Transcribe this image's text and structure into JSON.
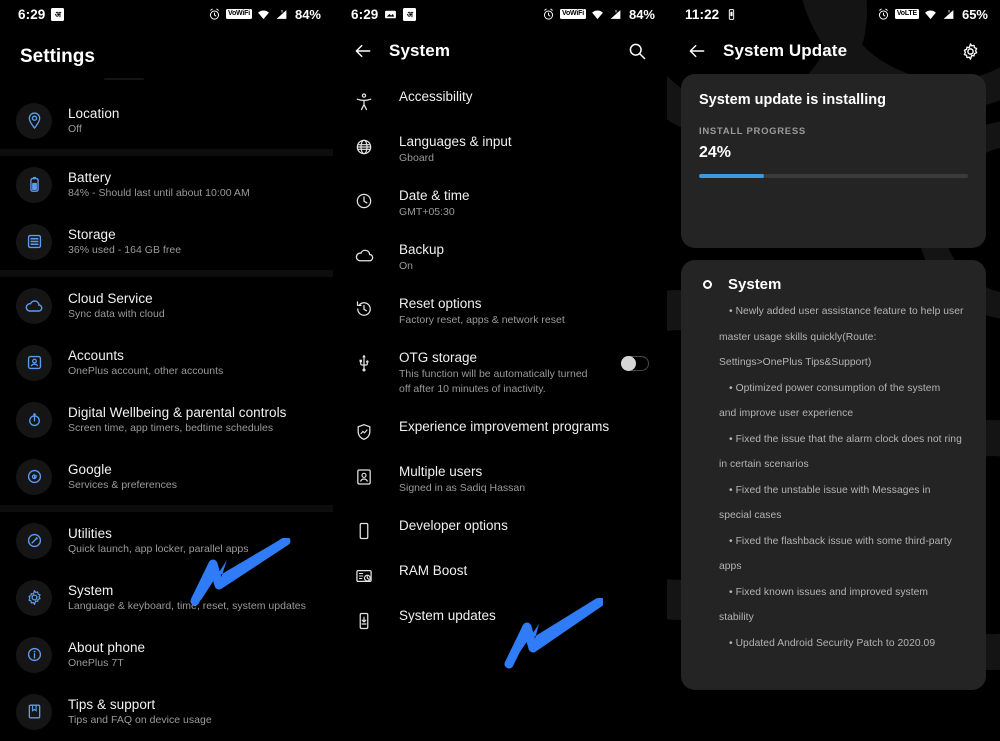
{
  "panels": {
    "settings": {
      "statusbar": {
        "time": "6:29",
        "notif_icon": "app-notification-icon",
        "alarm": "alarm-icon",
        "vowifi": "VoWiFi",
        "battery": "84%"
      },
      "title": "Settings",
      "items": [
        {
          "icon": "location-icon",
          "title": "Location",
          "sub": "Off"
        },
        {
          "icon": "battery-icon",
          "title": "Battery",
          "sub": "84% - Should last until about 10:00 AM"
        },
        {
          "icon": "storage-icon",
          "title": "Storage",
          "sub": "36% used - 164 GB free"
        },
        {
          "icon": "cloud-icon",
          "title": "Cloud Service",
          "sub": "Sync data with cloud"
        },
        {
          "icon": "accounts-icon",
          "title": "Accounts",
          "sub": "OnePlus account, other accounts"
        },
        {
          "icon": "wellbeing-icon",
          "title": "Digital Wellbeing & parental controls",
          "sub": "Screen time, app timers, bedtime schedules"
        },
        {
          "icon": "google-icon",
          "title": "Google",
          "sub": "Services & preferences"
        },
        {
          "icon": "utilities-icon",
          "title": "Utilities",
          "sub": "Quick launch, app locker, parallel apps"
        },
        {
          "icon": "gear-icon",
          "title": "System",
          "sub": "Language & keyboard, time, reset, system updates"
        },
        {
          "icon": "info-icon",
          "title": "About phone",
          "sub": "OnePlus 7T"
        },
        {
          "icon": "tips-icon",
          "title": "Tips & support",
          "sub": "Tips and FAQ on device usage"
        }
      ]
    },
    "system": {
      "statusbar": {
        "time": "6:29",
        "vowifi": "VoWiFi",
        "battery": "84%"
      },
      "title": "System",
      "back": "back-arrow",
      "search": "search-icon",
      "items": [
        {
          "icon": "accessibility-icon",
          "title": "Accessibility",
          "sub": ""
        },
        {
          "icon": "globe-icon",
          "title": "Languages & input",
          "sub": "Gboard"
        },
        {
          "icon": "clock-icon",
          "title": "Date & time",
          "sub": "GMT+05:30"
        },
        {
          "icon": "cloud-icon",
          "title": "Backup",
          "sub": "On"
        },
        {
          "icon": "reset-icon",
          "title": "Reset options",
          "sub": "Factory reset, apps & network reset"
        },
        {
          "icon": "usb-icon",
          "title": "OTG storage",
          "sub": "This function will be automatically turned off after 10 minutes of inactivity.",
          "toggle": "off"
        },
        {
          "icon": "shield-chart-icon",
          "title": "Experience improvement programs",
          "sub": ""
        },
        {
          "icon": "user-icon",
          "title": "Multiple users",
          "sub": "Signed in as Sadiq Hassan"
        },
        {
          "icon": "phone-icon",
          "title": "Developer options",
          "sub": ""
        },
        {
          "icon": "ram-boost-icon",
          "title": "RAM Boost",
          "sub": ""
        },
        {
          "icon": "system-update-icon",
          "title": "System updates",
          "sub": ""
        }
      ]
    },
    "update": {
      "statusbar": {
        "time": "11:22",
        "volte": "VoLTE",
        "battery": "65%"
      },
      "title": "System Update",
      "back": "back-arrow",
      "settings_icon": "gear-icon",
      "card": {
        "heading": "System update is installing",
        "progress_label": "INSTALL PROGRESS",
        "progress_value": "24%",
        "progress_percent": 24
      },
      "changelog": {
        "section": "System",
        "lines": [
          "• Newly added user assistance feature to help user",
          "master usage skills quickly(Route:",
          "Settings>OnePlus Tips&Support)",
          "• Optimized power consumption of the system",
          "and improve user experience",
          "• Fixed the issue that the alarm clock does not ring",
          "in certain scenarios",
          "• Fixed the unstable issue with Messages in",
          "special cases",
          "• Fixed the flashback issue with some third-party",
          "apps",
          "• Fixed known issues and improved system",
          "stability",
          "• Updated Android Security Patch to 2020.09"
        ]
      }
    }
  },
  "annotations": {
    "arrow_color": "#2f7cf6",
    "arrow1": "arrow-pointing-to-system-row",
    "arrow2": "arrow-pointing-to-system-updates-row"
  }
}
